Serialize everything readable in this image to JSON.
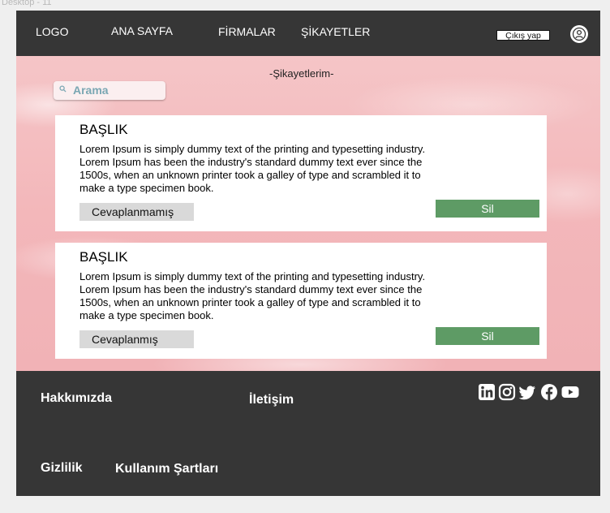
{
  "frame_label": "Desktop - 11",
  "nav": {
    "logo": "LOGO",
    "items": [
      "ANA SAYFA",
      "FİRMALAR",
      "ŞİKAYETLER"
    ],
    "logout_label": "Çıkış yap"
  },
  "page": {
    "title": "-Şikayetlerim-",
    "search_placeholder": "Arama"
  },
  "complaints": [
    {
      "title": "BAŞLIK",
      "body": "Lorem Ipsum is simply dummy text of the printing and typesetting industry. Lorem Ipsum has been the industry's standard dummy text ever since the 1500s, when an unknown printer took a galley of type and scrambled it to make a type specimen book.",
      "status": "Cevaplanmamış",
      "delete_label": "Sil"
    },
    {
      "title": "BAŞLIK",
      "body": "Lorem Ipsum is simply dummy text of the printing and typesetting industry. Lorem Ipsum has been the industry's standard dummy text ever since the 1500s, when an unknown printer took a galley of type and scrambled it to make a type specimen book.",
      "status": "Cevaplanmış",
      "delete_label": "Sil"
    }
  ],
  "footer": {
    "about": "Hakkımızda",
    "contact": "İletişim",
    "privacy": "Gizlilik",
    "terms": "Kullanım Şartları",
    "social_icons": [
      "linkedin-icon",
      "instagram-icon",
      "twitter-icon",
      "facebook-icon",
      "youtube-icon"
    ]
  },
  "colors": {
    "navbar": "#363636",
    "hero_pink": "#f3b7ba",
    "delete_green": "#5e9b65",
    "status_gray": "#d9d9d9",
    "search_text": "#7aa7b3"
  }
}
